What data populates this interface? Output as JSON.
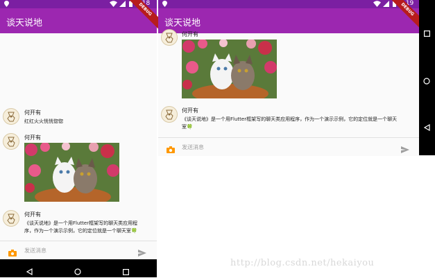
{
  "app": {
    "title": "谈天说地"
  },
  "status": {
    "time_left": "5:18",
    "time_right": "5:19",
    "debug_label": "DEBUG"
  },
  "messages_left": [
    {
      "sender": "何开有",
      "text": "红红火火恍恍惚惚"
    },
    {
      "sender": "何开有",
      "image": "kitten-photo"
    },
    {
      "sender": "何开有",
      "text_line1": "《谈天说地》是一个用Flutter框架写的聊天类应用程",
      "text_line2": "序，作为一个演示示例，它的定位就是一个聊天室🍀"
    }
  ],
  "messages_right": [
    {
      "sender": "何开有",
      "image": "kitten-photo"
    },
    {
      "sender": "何开有",
      "text_line1": "《谈天说地》是一个用Flutter框架写的聊天类应用程序，作为一个演示示例，它的定位就是一个聊天",
      "text_line2": "室🍀"
    }
  ],
  "composer": {
    "placeholder": "发送消息"
  },
  "watermark": "http://blog.csdn.net/hekaiyou",
  "colors": {
    "status_bar": "#7b1fa2",
    "app_bar": "#9c27b0",
    "accent": "#ff9800"
  }
}
